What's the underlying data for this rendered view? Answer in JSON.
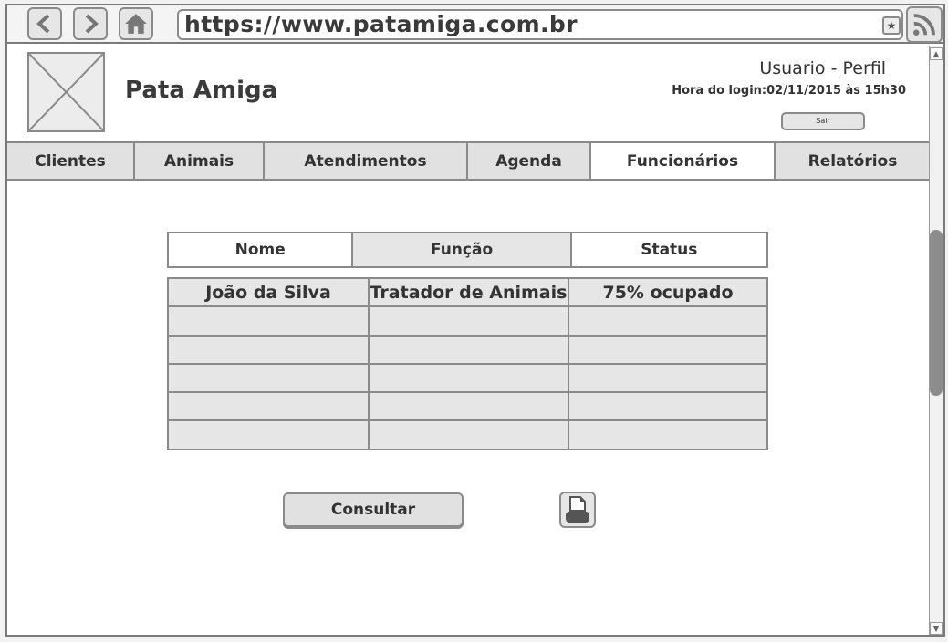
{
  "browser": {
    "url": "https://www.patamiga.com.br",
    "star_glyph": "★"
  },
  "header": {
    "brand": "Pata Amiga",
    "user_label": "Usuario - Perfil",
    "login_info": "Hora do login:02/11/2015 às 15h30",
    "logout_label": "Sair"
  },
  "tabs": [
    {
      "label": "Clientes"
    },
    {
      "label": "Animais"
    },
    {
      "label": "Atendimentos"
    },
    {
      "label": "Agenda"
    },
    {
      "label": "Funcionários"
    },
    {
      "label": "Relatórios"
    }
  ],
  "table": {
    "headers": [
      "Nome",
      "Função",
      "Status"
    ],
    "rows": [
      [
        "João da Silva",
        "Tratador de Animais",
        "75% ocupado"
      ],
      [
        "",
        "",
        ""
      ],
      [
        "",
        "",
        ""
      ],
      [
        "",
        "",
        ""
      ],
      [
        "",
        "",
        ""
      ],
      [
        "",
        "",
        ""
      ]
    ]
  },
  "actions": {
    "consult_label": "Consultar"
  },
  "colors": {
    "border": "#8a8a8a",
    "fill": "#e6e6e6",
    "active_tab": "#ffffff"
  }
}
